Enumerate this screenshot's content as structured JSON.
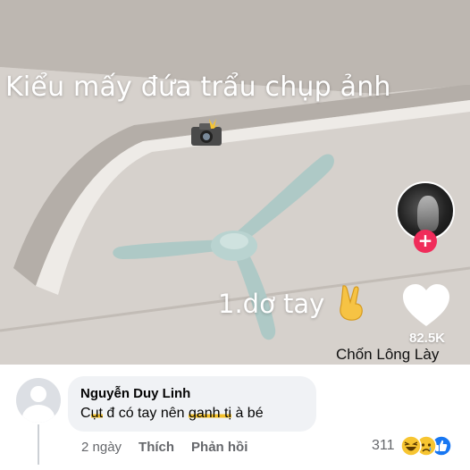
{
  "video": {
    "caption": "Kiểu mấy đứa trẩu chụp ảnh",
    "camera_emoji": "camera-with-flash-icon",
    "overlay_text": "1.dơ tay",
    "victory_emoji": "victory-hand-icon",
    "follow_symbol": "+",
    "like_count": "82.5K",
    "watermark": "Chốn Lông Lày"
  },
  "comment": {
    "author": "Nguyễn Duy Linh",
    "text_parts": {
      "p1": "C",
      "hl1": "ụt",
      "p2": " đ có tay nên ",
      "hl2": "ganh tị",
      "p3": " à bé"
    },
    "time": "2 ngày",
    "like_action": "Thích",
    "reply_action": "Phản hồi",
    "reaction_count": "311",
    "reactions": [
      "haha-icon",
      "sad-icon",
      "like-icon"
    ]
  },
  "colors": {
    "facebook_blue": "#1877f2",
    "follow_pink": "#f02c5a",
    "highlight_yellow": "#f3c02a",
    "bubble_gray": "#f0f2f5"
  }
}
